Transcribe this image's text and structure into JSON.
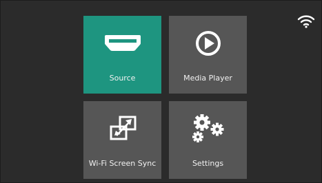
{
  "status": {
    "wifi_icon": "wifi-icon"
  },
  "menu": {
    "tiles": [
      {
        "label": "Source",
        "icon": "hdmi-icon",
        "selected": true
      },
      {
        "label": "Media Player",
        "icon": "play-icon",
        "selected": false
      },
      {
        "label": "Wi-Fi Screen Sync",
        "icon": "screen-mirror-icon",
        "selected": false
      },
      {
        "label": "Settings",
        "icon": "gears-icon",
        "selected": false
      }
    ]
  },
  "colors": {
    "background": "#2b2b2b",
    "tile": "#565656",
    "selected_tile": "#1e9580",
    "text": "#ffffff"
  }
}
